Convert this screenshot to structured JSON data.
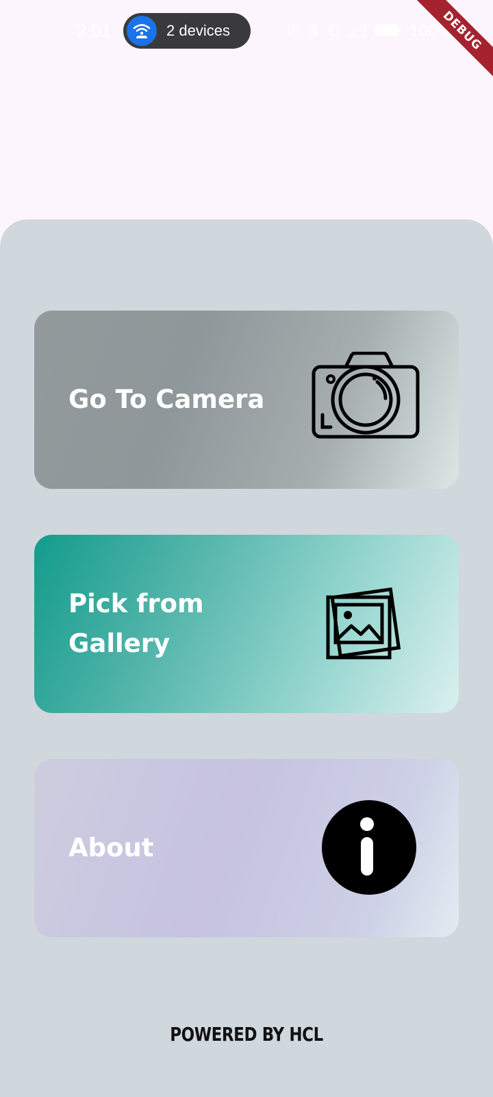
{
  "status_bar": {
    "time": "2:01",
    "devices_label": "2 devices",
    "battery": "100%"
  },
  "debug_banner": "DEBUG",
  "cards": [
    {
      "label": "Go To Camera",
      "icon": "camera-icon",
      "color_start": "#949a9c",
      "color_end": "#dce7e5"
    },
    {
      "label": "Pick from Gallery",
      "icon": "gallery-icon",
      "color_start": "#129c8c",
      "color_end": "#daf0ee"
    },
    {
      "label": "About",
      "icon": "info-icon",
      "color_start": "#cdcddf",
      "color_end": "#e2ecf1"
    }
  ],
  "footer": "POWERED BY HCL",
  "colors": {
    "page_background": "#fdf5fd",
    "panel_background": "#d0d7dd",
    "debug_ribbon": "#a5232f",
    "device_pill": "#3a3a3c",
    "wifi_badge": "#1a73e8"
  }
}
